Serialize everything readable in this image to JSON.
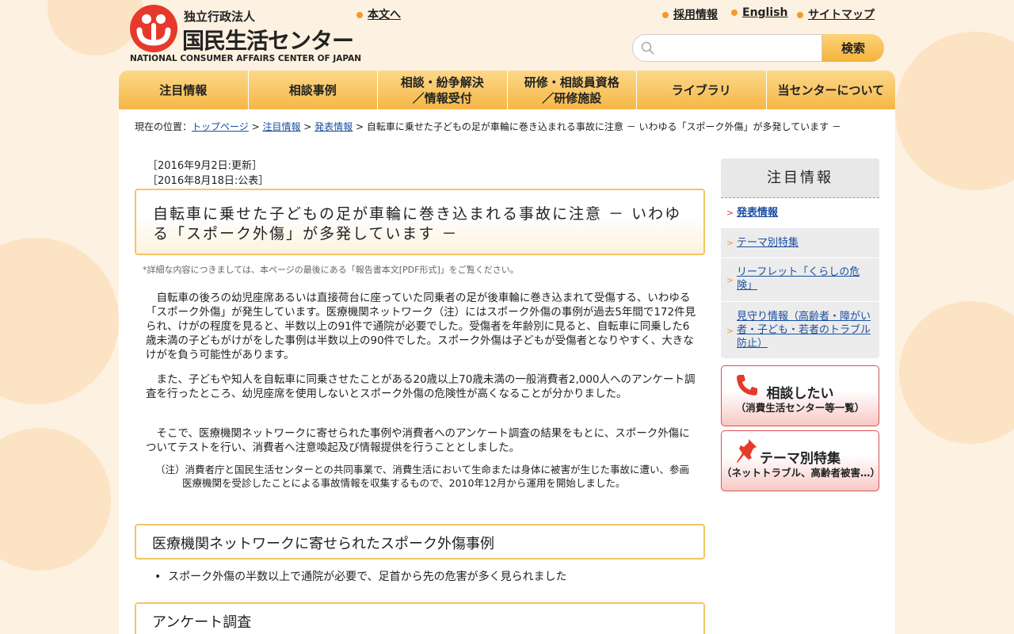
{
  "header": {
    "logo_line1": "独立行政法人",
    "logo_line2": "国民生活センター",
    "logo_line3": "NATIONAL CONSUMER AFFAIRS CENTER OF JAPAN",
    "skip_link": "本文へ",
    "links": [
      "採用情報",
      "English",
      "サイトマップ"
    ],
    "search_placeholder": "",
    "search_button": "検索"
  },
  "nav": [
    "注目情報",
    "相談事例",
    "相談・紛争解決\n／情報受付",
    "研修・相談員資格\n／研修施設",
    "ライブラリ",
    "当センターについて"
  ],
  "breadcrumb": {
    "prefix": "現在の位置：",
    "links": [
      "トップページ",
      "注目情報",
      "発表情報"
    ],
    "sep": " > ",
    "current": "自転車に乗せた子どもの足が車輪に巻き込まれる事故に注意 － いわゆる「スポーク外傷」が多発しています －"
  },
  "dates": {
    "updated": "［2016年9月2日:更新］",
    "published": "［2016年8月18日:公表］"
  },
  "title": "自転車に乗せた子どもの足が車輪に巻き込まれる事故に注意 － いわゆる「スポーク外傷」が多発しています －",
  "note": "*詳細な内容につきましては、本ページの最後にある「報告書本文[PDF形式]」をご覧ください。",
  "paragraphs": [
    "　自転車の後ろの幼児座席あるいは直接荷台に座っていた同乗者の足が後車輪に巻き込まれて受傷する、いわゆる「スポーク外傷」が発生しています。医療機関ネットワーク（注）にはスポーク外傷の事例が過去5年間で172件見られ、けがの程度を見ると、半数以上の91件で通院が必要でした。受傷者を年齢別に見ると、自転車に同乗した6歳未満の子どもがけがをした事例は半数以上の90件でした。スポーク外傷は子どもが受傷者となりやすく、大きなけがを負う可能性があります。",
    "　また、子どもや知人を自転車に同乗させたことがある20歳以上70歳未満の一般消費者2,000人へのアンケート調査を行ったところ、幼児座席を使用しないとスポーク外傷の危険性が高くなることが分かりました。",
    "　そこで、医療機関ネットワークに寄せられた事例や消費者へのアンケート調査の結果をもとに、スポーク外傷についてテストを行い、消費者へ注意喚起及び情報提供を行うこととしました。"
  ],
  "footnote": "（注）消費者庁と国民生活センターとの共同事業で、消費生活において生命または身体に被害が生じた事故に遭い、参画医療機関を受診したことによる事故情報を収集するもので、2010年12月から運用を開始しました。",
  "section1": {
    "heading": "医療機関ネットワークに寄せられたスポーク外傷事例",
    "bullet": "スポーク外傷の半数以上で通院が必要で、足首から先の危害が多く見られました"
  },
  "section2": {
    "heading": "アンケート調査"
  },
  "sidebar": {
    "heading": "注目情報",
    "items": [
      "発表情報",
      "テーマ別特集",
      "リーフレット「くらしの危険」",
      "見守り情報（高齢者・障がい者・子ども・若者のトラブル防止）"
    ],
    "buttons": [
      {
        "title": "相談したい",
        "sub": "（消費生活センター等一覧）"
      },
      {
        "title": "テーマ別特集",
        "sub": "（ネットトラブル、高齢者被害…）"
      }
    ]
  }
}
